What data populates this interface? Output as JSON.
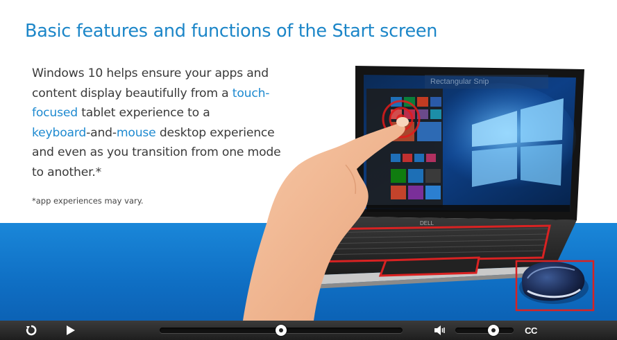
{
  "slide": {
    "title": "Basic features and functions of the Start screen",
    "body": {
      "t1": "Windows 10 helps ensure your apps and content display beautifully from a ",
      "link1": "touch-focused",
      "t2": " tablet experience to a ",
      "link2": "keyboard",
      "t3": "-and-",
      "link3": "mouse",
      "t4": " desktop experience and even as you transition from one mode to another.*"
    },
    "footnote": "*app experiences may vary.",
    "snip_label": "Rectangular Snip",
    "laptop_brand": "DELL"
  },
  "player": {
    "progress": 0.5,
    "volume": 0.65,
    "cc_label": "CC",
    "icons": [
      "replay-icon",
      "play-icon",
      "volume-icon"
    ]
  },
  "colors": {
    "title": "#1c86c8",
    "highlight": "#1e8ad0",
    "band": "#1377cd",
    "highlight_box": "#d42020",
    "controls_bg": "#2a2a2a"
  }
}
